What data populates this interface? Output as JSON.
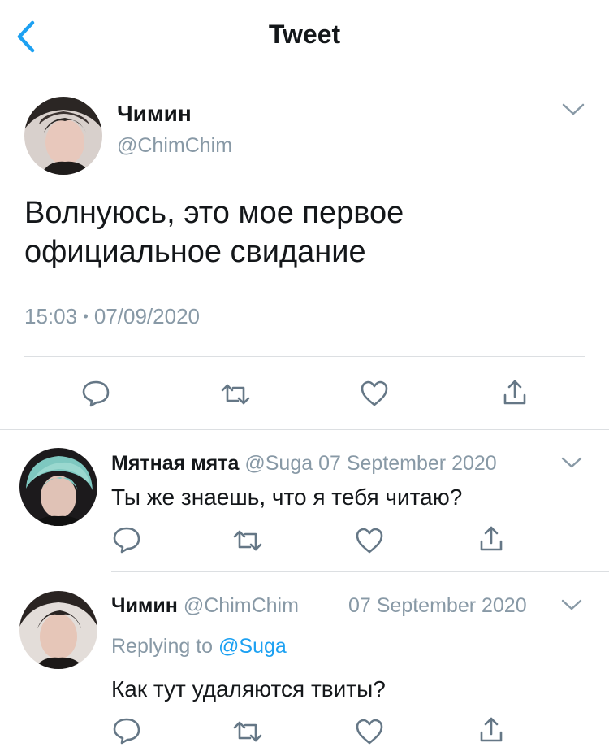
{
  "header": {
    "title": "Tweet"
  },
  "main_tweet": {
    "author_name": "Чимин",
    "author_handle": "@ChimChim",
    "text_line1": "Волнуюсь, это мое первое",
    "text_line2": "официальное свидание",
    "time": "15:03",
    "separator": "•",
    "date": "07/09/2020"
  },
  "replies": [
    {
      "author_name": "Мятная мята",
      "author_handle": "@Suga",
      "date": "07 September 2020",
      "text": "Ты же знаешь, что я тебя читаю?"
    },
    {
      "author_name": "Чимин",
      "author_handle": "@ChimChim",
      "date": "07 September 2020",
      "replying_label": "Replying to",
      "replying_handle": "@Suga",
      "text": "Как тут удаляются твиты?"
    }
  ],
  "colors": {
    "accent": "#1da1f2",
    "text": "#14171a",
    "muted": "#8899a6",
    "icon": "#657786",
    "divider": "#dcdfe2"
  }
}
